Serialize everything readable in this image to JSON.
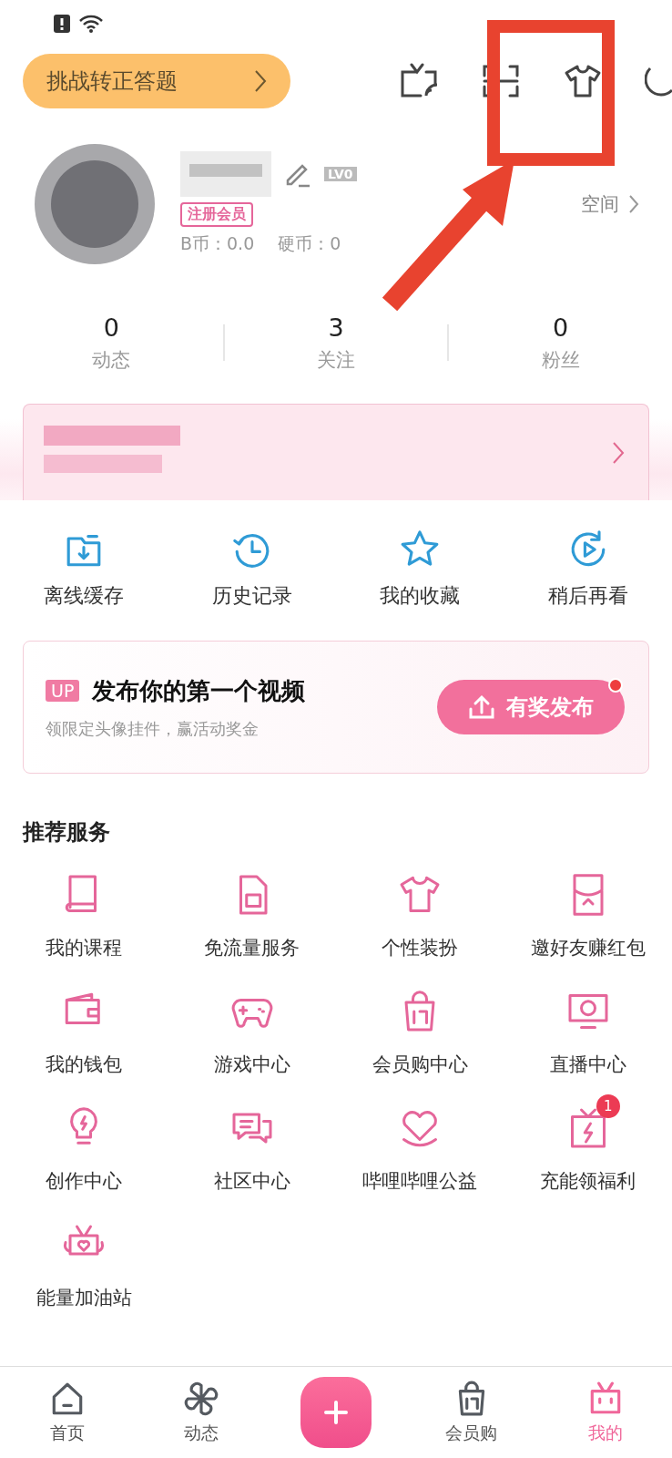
{
  "top_bar": {
    "challenge_button": "挑战转正答题"
  },
  "profile": {
    "member_tag": "注册会员",
    "level_badge": "LV0",
    "b_coins": "B币：0.0",
    "coins": "硬币：0",
    "space_link": "空间"
  },
  "stats": [
    {
      "value": "0",
      "label": "动态"
    },
    {
      "value": "3",
      "label": "关注"
    },
    {
      "value": "0",
      "label": "粉丝"
    }
  ],
  "quick_actions": [
    {
      "label": "离线缓存"
    },
    {
      "label": "历史记录"
    },
    {
      "label": "我的收藏"
    },
    {
      "label": "稍后再看"
    }
  ],
  "upload_card": {
    "tag": "UP",
    "title": "发布你的第一个视频",
    "subtitle": "领限定头像挂件，赢活动奖金",
    "button": "有奖发布",
    "notification_dot": true
  },
  "services": {
    "title": "推荐服务",
    "items": [
      {
        "label": "我的课程"
      },
      {
        "label": "免流量服务"
      },
      {
        "label": "个性装扮"
      },
      {
        "label": "邀好友赚红包"
      },
      {
        "label": "我的钱包"
      },
      {
        "label": "游戏中心"
      },
      {
        "label": "会员购中心"
      },
      {
        "label": "直播中心"
      },
      {
        "label": "创作中心"
      },
      {
        "label": "社区中心"
      },
      {
        "label": "哔哩哔哩公益"
      },
      {
        "label": "充能领福利",
        "badge": "1"
      },
      {
        "label": "能量加油站"
      }
    ]
  },
  "tab_bar": [
    {
      "label": "首页",
      "selected": false
    },
    {
      "label": "动态",
      "selected": false
    },
    {
      "kind": "add"
    },
    {
      "label": "会员购",
      "selected": false
    },
    {
      "label": "我的",
      "selected": true
    }
  ]
}
